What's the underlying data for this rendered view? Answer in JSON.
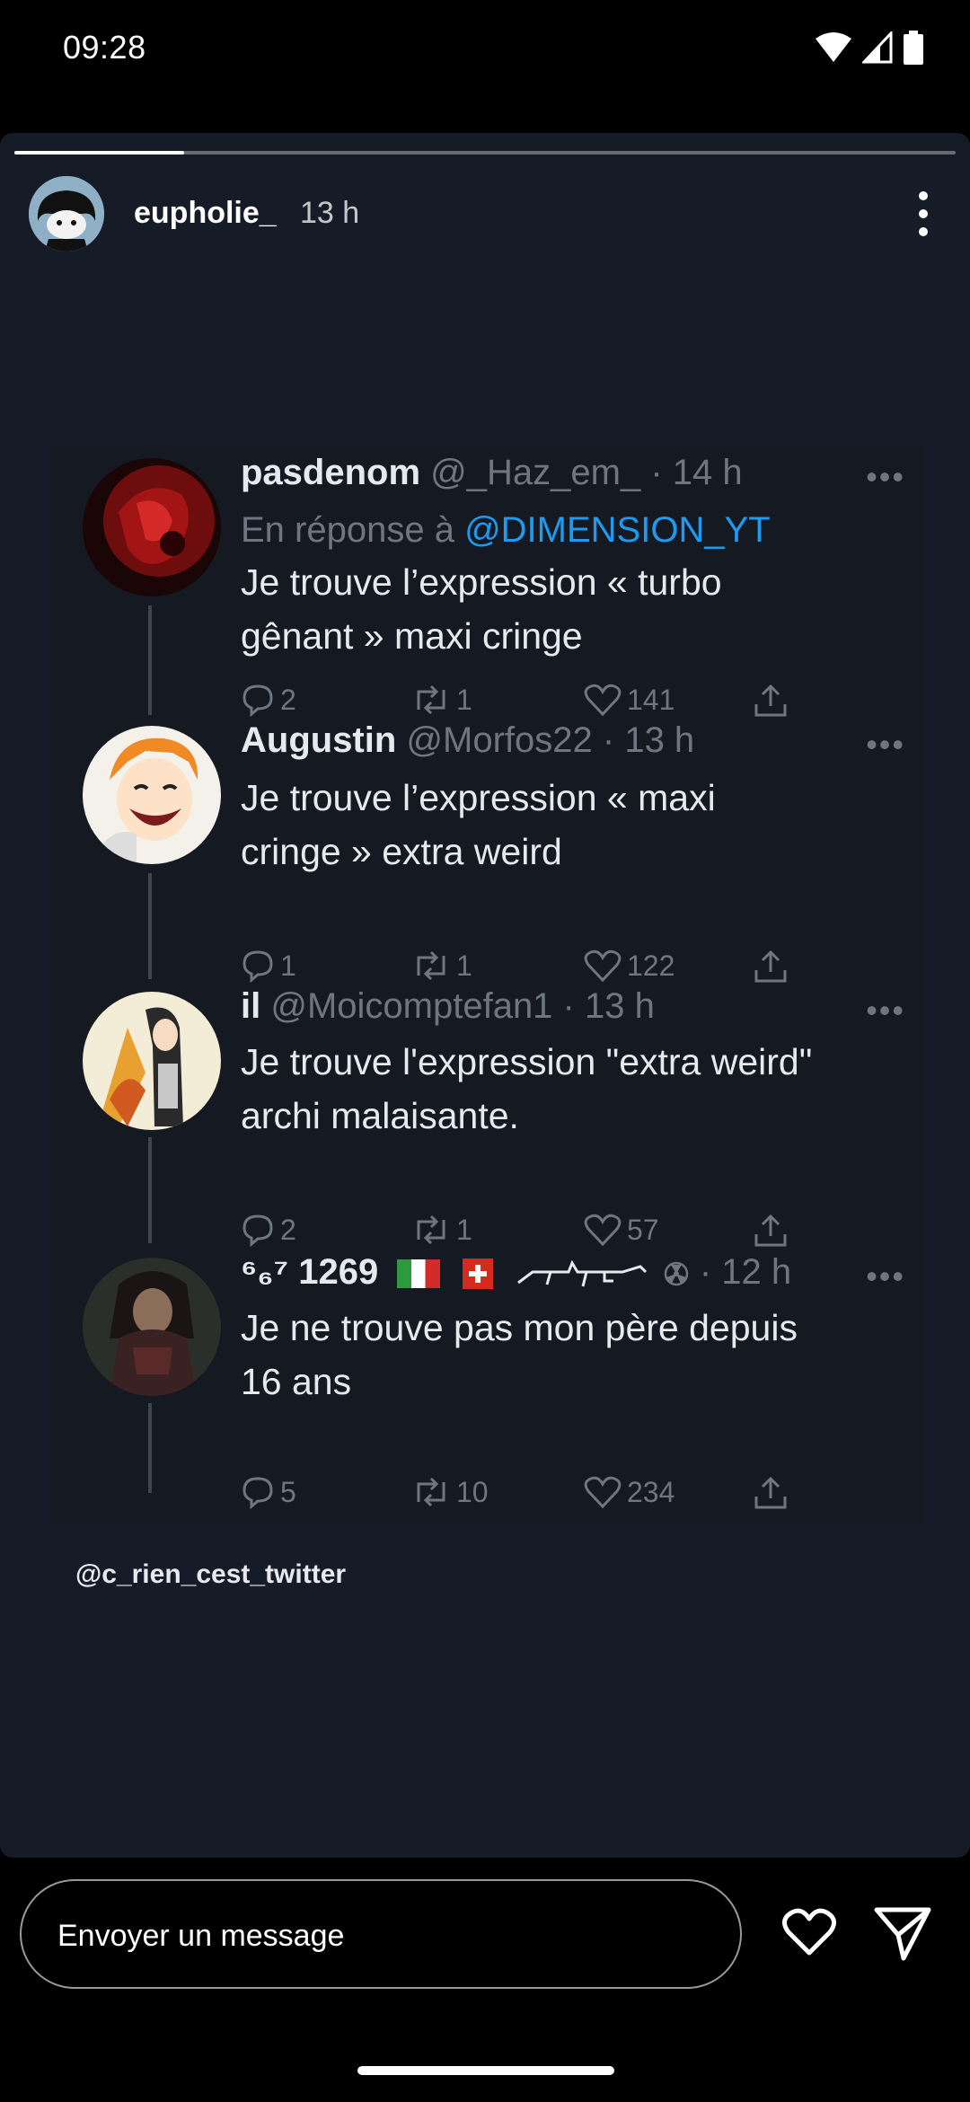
{
  "status_bar": {
    "time": "09:28"
  },
  "story": {
    "progress": 0.18,
    "username": "eupholie_",
    "time": "13 h"
  },
  "tweets": [
    {
      "name": "pasdenom",
      "meta": " @_Haz_em_ · 14 h",
      "reply_prefix": "En réponse à ",
      "reply_mention": "@DIMENSION_YT",
      "text_line1": "Je trouve l’expression « turbo",
      "text_line2": "gênant » maxi cringe",
      "replies": "2",
      "retweets": "1",
      "likes": "141"
    },
    {
      "name": "Augustin",
      "meta": " @Morfos22 · 13 h",
      "text_line1": "Je trouve l’expression « maxi",
      "text_line2": "cringe » extra weird",
      "replies": "1",
      "retweets": "1",
      "likes": "122"
    },
    {
      "name": "il",
      "meta": " @Moicomptefan1 · 13 h",
      "text_line1": "Je trouve l'expression \"extra weird\"",
      "text_line2": "archi malaisante.",
      "replies": "2",
      "retweets": "1",
      "likes": "57"
    },
    {
      "name": "⁶₆⁷ 1269",
      "meta": " · 12 h",
      "text_line1": "Je ne trouve pas mon père depuis",
      "text_line2": "16 ans",
      "replies": "5",
      "retweets": "10",
      "likes": "234"
    }
  ],
  "credit": "@c_rien_cest_twitter",
  "bottom": {
    "placeholder": "Envoyer un message"
  },
  "colors": {
    "story_bg": "#161c27",
    "mention": "#1d9bf0",
    "muted": "#6e7781"
  }
}
